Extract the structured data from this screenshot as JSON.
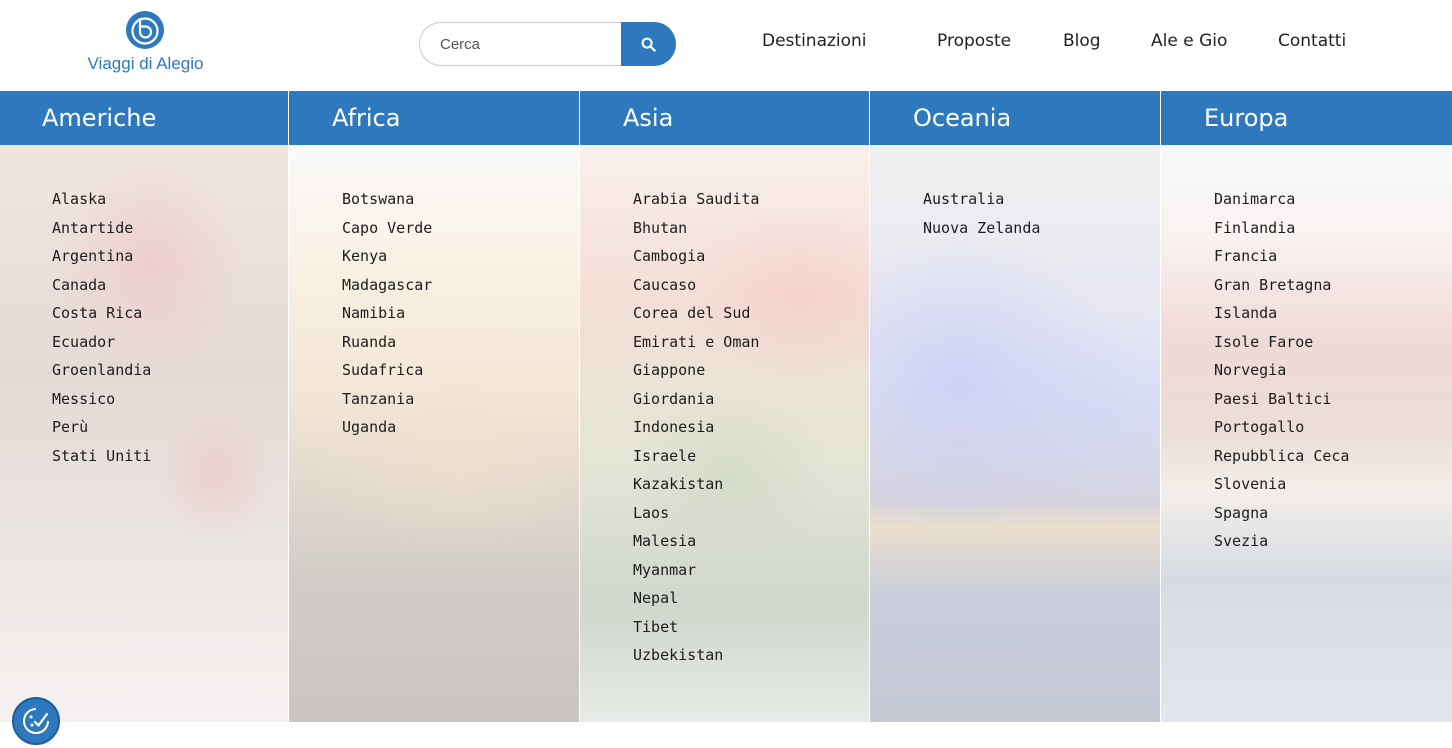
{
  "brand": {
    "name": "Viaggi di Alegio",
    "accent_color": "#2e78be",
    "logo_icon": "alegio-logo-mark"
  },
  "search": {
    "placeholder": "Cerca",
    "value": "",
    "button_icon": "search-icon"
  },
  "nav": {
    "items": [
      {
        "label": "Destinazioni"
      },
      {
        "label": "Proposte"
      },
      {
        "label": "Blog"
      },
      {
        "label": "Ale e Gio"
      },
      {
        "label": "Contatti"
      }
    ]
  },
  "regions": [
    {
      "title": "Americhe",
      "countries": [
        "Alaska",
        "Antartide",
        "Argentina",
        "Canada",
        "Costa Rica",
        "Ecuador",
        "Groenlandia",
        "Messico",
        "Perù",
        "Stati Uniti"
      ]
    },
    {
      "title": "Africa",
      "countries": [
        "Botswana",
        "Capo Verde",
        "Kenya",
        "Madagascar",
        "Namibia",
        "Ruanda",
        "Sudafrica",
        "Tanzania",
        "Uganda"
      ]
    },
    {
      "title": "Asia",
      "countries": [
        "Arabia Saudita",
        "Bhutan",
        "Cambogia",
        "Caucaso",
        "Corea del Sud",
        "Emirati e Oman",
        "Giappone",
        "Giordania",
        "Indonesia",
        "Israele",
        "Kazakistan",
        "Laos",
        "Malesia",
        "Myanmar",
        "Nepal",
        "Tibet",
        "Uzbekistan"
      ]
    },
    {
      "title": "Oceania",
      "countries": [
        "Australia",
        "Nuova Zelanda"
      ]
    },
    {
      "title": "Europa",
      "countries": [
        "Danimarca",
        "Finlandia",
        "Francia",
        "Gran Bretagna",
        "Islanda",
        "Isole Faroe",
        "Norvegia",
        "Paesi Baltici",
        "Portogallo",
        "Repubblica Ceca",
        "Slovenia",
        "Spagna",
        "Svezia"
      ]
    }
  ],
  "cookie_button": {
    "icon": "cookie-consent-icon"
  }
}
